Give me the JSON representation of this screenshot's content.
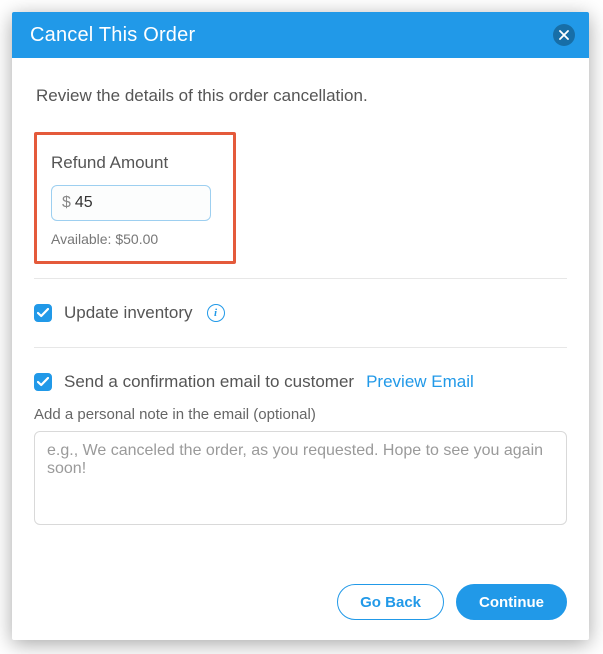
{
  "header": {
    "title": "Cancel This Order"
  },
  "instructions": "Review the details of this order cancellation.",
  "refund": {
    "label": "Refund Amount",
    "currency_symbol": "$",
    "value": "45",
    "available_text": "Available: $50.00"
  },
  "update_inventory": {
    "label": "Update inventory",
    "checked": true
  },
  "send_email": {
    "label": "Send a confirmation email to customer",
    "preview_link": "Preview Email",
    "checked": true,
    "note_label": "Add a personal note in the email (optional)",
    "note_placeholder": "e.g., We canceled the order, as you requested. Hope to see you again soon!"
  },
  "buttons": {
    "go_back": "Go Back",
    "continue": "Continue"
  }
}
